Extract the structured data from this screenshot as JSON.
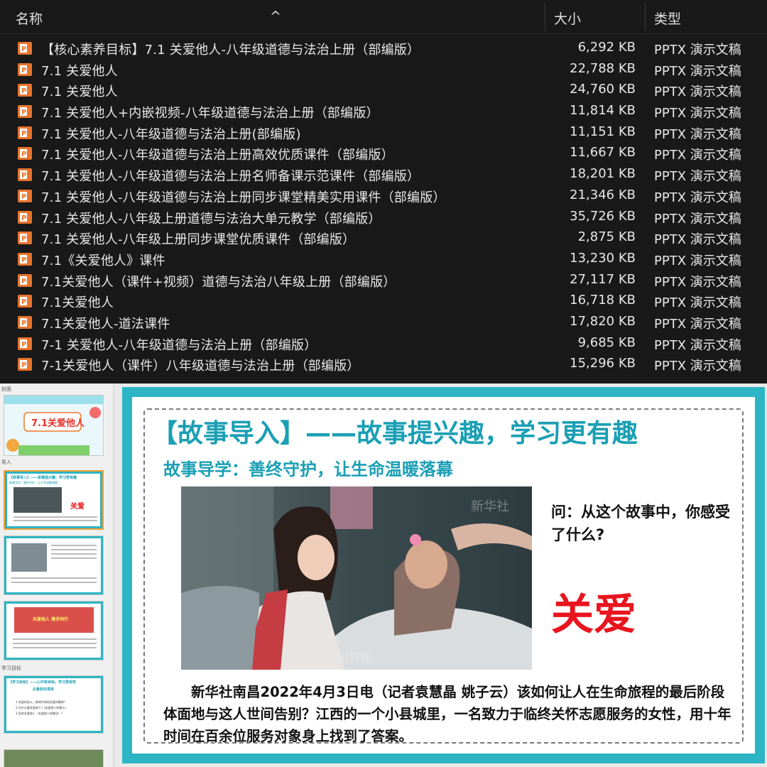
{
  "explorer": {
    "columns": {
      "name": "名称",
      "size": "大小",
      "type": "类型"
    },
    "files": [
      {
        "name": "【核心素养目标】7.1 关爱他人-八年级道德与法治上册（部编版）",
        "size": "6,292 KB",
        "type": "PPTX 演示文稿"
      },
      {
        "name": "7.1  关爱他人",
        "size": "22,788 KB",
        "type": "PPTX 演示文稿"
      },
      {
        "name": "7.1 关爱他人",
        "size": "24,760 KB",
        "type": "PPTX 演示文稿"
      },
      {
        "name": "7.1 关爱他人+内嵌视频-八年级道德与法治上册（部编版）",
        "size": "11,814 KB",
        "type": "PPTX 演示文稿"
      },
      {
        "name": "7.1 关爱他人-八年级道德与法治上册(部编版)",
        "size": "11,151 KB",
        "type": "PPTX 演示文稿"
      },
      {
        "name": "7.1 关爱他人-八年级道德与法治上册高效优质课件（部编版）",
        "size": "11,667 KB",
        "type": "PPTX 演示文稿"
      },
      {
        "name": "7.1 关爱他人-八年级道德与法治上册名师备课示范课件（部编版）",
        "size": "18,201 KB",
        "type": "PPTX 演示文稿"
      },
      {
        "name": "7.1 关爱他人-八年级道德与法治上册同步课堂精美实用课件（部编版）",
        "size": "21,346 KB",
        "type": "PPTX 演示文稿"
      },
      {
        "name": "7.1 关爱他人-八年级上册道德与法治大单元教学（部编版）",
        "size": "35,726 KB",
        "type": "PPTX 演示文稿"
      },
      {
        "name": "7.1 关爱他人-八年级上册同步课堂优质课件（部编版）",
        "size": "2,875 KB",
        "type": "PPTX 演示文稿"
      },
      {
        "name": "7.1《关爱他人》课件",
        "size": "13,230 KB",
        "type": "PPTX 演示文稿"
      },
      {
        "name": "7.1关爱他人（课件+视频）道德与法治八年级上册（部编版）",
        "size": "27,117 KB",
        "type": "PPTX 演示文稿"
      },
      {
        "name": "7.1关爱他人",
        "size": "16,718 KB",
        "type": "PPTX 演示文稿"
      },
      {
        "name": "7.1关爱他人-道法课件",
        "size": "17,820 KB",
        "type": "PPTX 演示文稿"
      },
      {
        "name": "7-1 关爱他人-八年级道德与法治上册（部编版）",
        "size": "9,685 KB",
        "type": "PPTX 演示文稿"
      },
      {
        "name": "7-1关爱他人（课件）八年级道德与法治上册（部编版）",
        "size": "15,296 KB",
        "type": "PPTX 演示文稿"
      }
    ],
    "icon": "pptx-file-icon",
    "accent": "#e8742b"
  },
  "ppt": {
    "sections": [
      "封面",
      "导入",
      "学习目标"
    ],
    "thumbnails": {
      "t1_title": "7.1关爱他人",
      "t2_header": "【故事导入】——故事提兴趣，学习更有趣",
      "t2_sub": "故事导学：善终守护，让生命温暖落幕",
      "t2_word": "关爱",
      "t3_banner": "关爱他人 携手同行",
      "t4_header": "【学习目标】——心中有目标，学习更有效",
      "t4_sub": "必备知识清单",
      "t4_item1": "1.关爱的含义，新闻中体现关爱的事例？",
      "t4_item2": "2.为什么要关爱他人？(关爱他人的意义)",
      "t4_item3": "3.怎样关爱他人（关爱他人的做法）?"
    },
    "slide": {
      "title": "【故事导入】——故事提兴趣，学习更有趣",
      "subtitle": "故事导学：善终守护，让生命温暖落幕",
      "photo_caption": "叫阿姨",
      "photo_watermark": "新华社",
      "question": "问：从这个故事中，你感受了什么?",
      "answer": "关爱",
      "body": "新华社南昌2022年4月3日电（记者袁慧晶 姚子云）该如何让人在生命旅程的最后阶段体面地与这人世间告别？江西的一个小县城里，一名致力于临终关怀志愿服务的女性，用十年时间在百余位服务对象身上找到了答案。",
      "frame_color": "#2cb5c4",
      "title_color": "#1a9fb4",
      "answer_color": "#e8141e"
    }
  }
}
